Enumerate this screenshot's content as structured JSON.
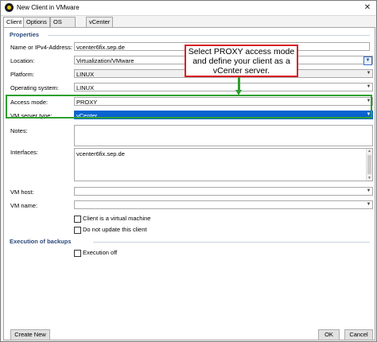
{
  "window": {
    "title": "New Client in VMware",
    "close_glyph": "✕",
    "app_icon": "sep-logo-icon"
  },
  "tabs": [
    {
      "label": "Client",
      "active": true
    },
    {
      "label": "Options",
      "active": false
    },
    {
      "label": "OS Access",
      "active": false
    },
    {
      "label": "vCenter Access",
      "active": false
    }
  ],
  "properties": {
    "section_title": "Properties",
    "name_label": "Name or IPv4-Address:",
    "name_value": "vcenter6fix.sep.de",
    "location_label": "Location:",
    "location_value": "Virtualization/VMware",
    "platform_label": "Platform:",
    "platform_value": "LINUX",
    "os_label": "Operating system:",
    "os_value": "LINUX",
    "access_mode_label": "Access mode:",
    "access_mode_value": "PROXY",
    "vm_server_type_label": "VM server type:",
    "vm_server_type_value": "vCenter",
    "notes_label": "Notes:",
    "notes_value": "",
    "interfaces_label": "Interfaces:",
    "interfaces_value": "vcenter6fix.sep.de",
    "vm_host_label": "VM host:",
    "vm_host_value": "",
    "vm_name_label": "VM name:",
    "vm_name_value": "",
    "client_virtual_label": "Client is a virtual machine",
    "client_virtual_checked": false,
    "do_not_update_label": "Do not update this client",
    "do_not_update_checked": false
  },
  "execution": {
    "section_title": "Execution of backups",
    "execution_off_label": "Execution off",
    "execution_off_checked": false
  },
  "buttons": {
    "create_new": "Create New",
    "ok": "OK",
    "cancel": "Cancel"
  },
  "callout": {
    "text": "Select PROXY access mode and define your client as a vCenter server."
  },
  "colors": {
    "highlight_green": "#2ea02e",
    "callout_red": "#d81f26",
    "selection_blue": "#0a64d1",
    "section_blue": "#2b4a78"
  }
}
